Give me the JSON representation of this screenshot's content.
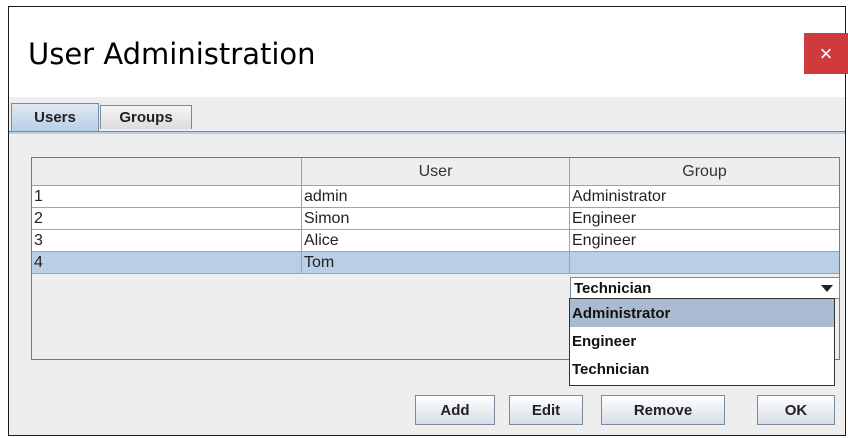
{
  "window": {
    "title": "User Administration",
    "close_label": "×"
  },
  "tabs": [
    {
      "label": "Users",
      "active": true
    },
    {
      "label": "Groups",
      "active": false
    }
  ],
  "table": {
    "columns": [
      "",
      "User",
      "Group"
    ],
    "rows": [
      {
        "id": "1",
        "user": "admin",
        "group": "Administrator"
      },
      {
        "id": "2",
        "user": "Simon",
        "group": "Engineer"
      },
      {
        "id": "3",
        "user": "Alice",
        "group": "Engineer"
      },
      {
        "id": "4",
        "user": "Tom",
        "group": "Technician",
        "selected": true
      }
    ]
  },
  "group_editor": {
    "selected": "Technician",
    "options": [
      "Administrator",
      "Engineer",
      "Technician"
    ],
    "highlighted": "Administrator"
  },
  "buttons": {
    "add": "Add",
    "edit": "Edit",
    "remove": "Remove",
    "ok": "OK"
  },
  "colors": {
    "close_bg": "#cf3b3c",
    "selection": "#b8cfe5",
    "option_highlight": "#a9bbd0"
  },
  "icons": {
    "close": "close-icon",
    "dropdown": "chevron-down-icon"
  }
}
